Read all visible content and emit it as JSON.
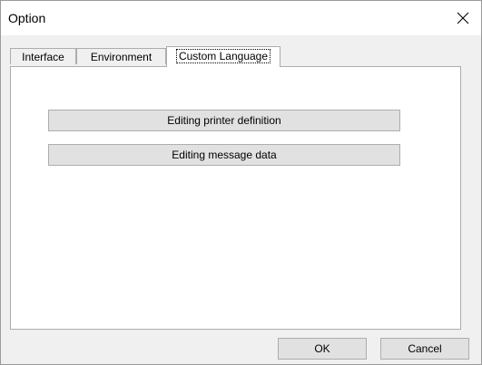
{
  "window": {
    "title": "Option",
    "close_icon": "close-icon"
  },
  "tabs": [
    {
      "label": "Interface",
      "active": false
    },
    {
      "label": "Environment",
      "active": false
    },
    {
      "label": "Custom Language",
      "active": true
    }
  ],
  "panel": {
    "buttons": [
      {
        "label": "Editing printer definition"
      },
      {
        "label": "Editing message data"
      }
    ]
  },
  "footer": {
    "ok_label": "OK",
    "cancel_label": "Cancel"
  },
  "colors": {
    "window_bg": "#f0f0f0",
    "panel_bg": "#ffffff",
    "button_bg": "#e1e1e1",
    "border": "#adadad"
  }
}
